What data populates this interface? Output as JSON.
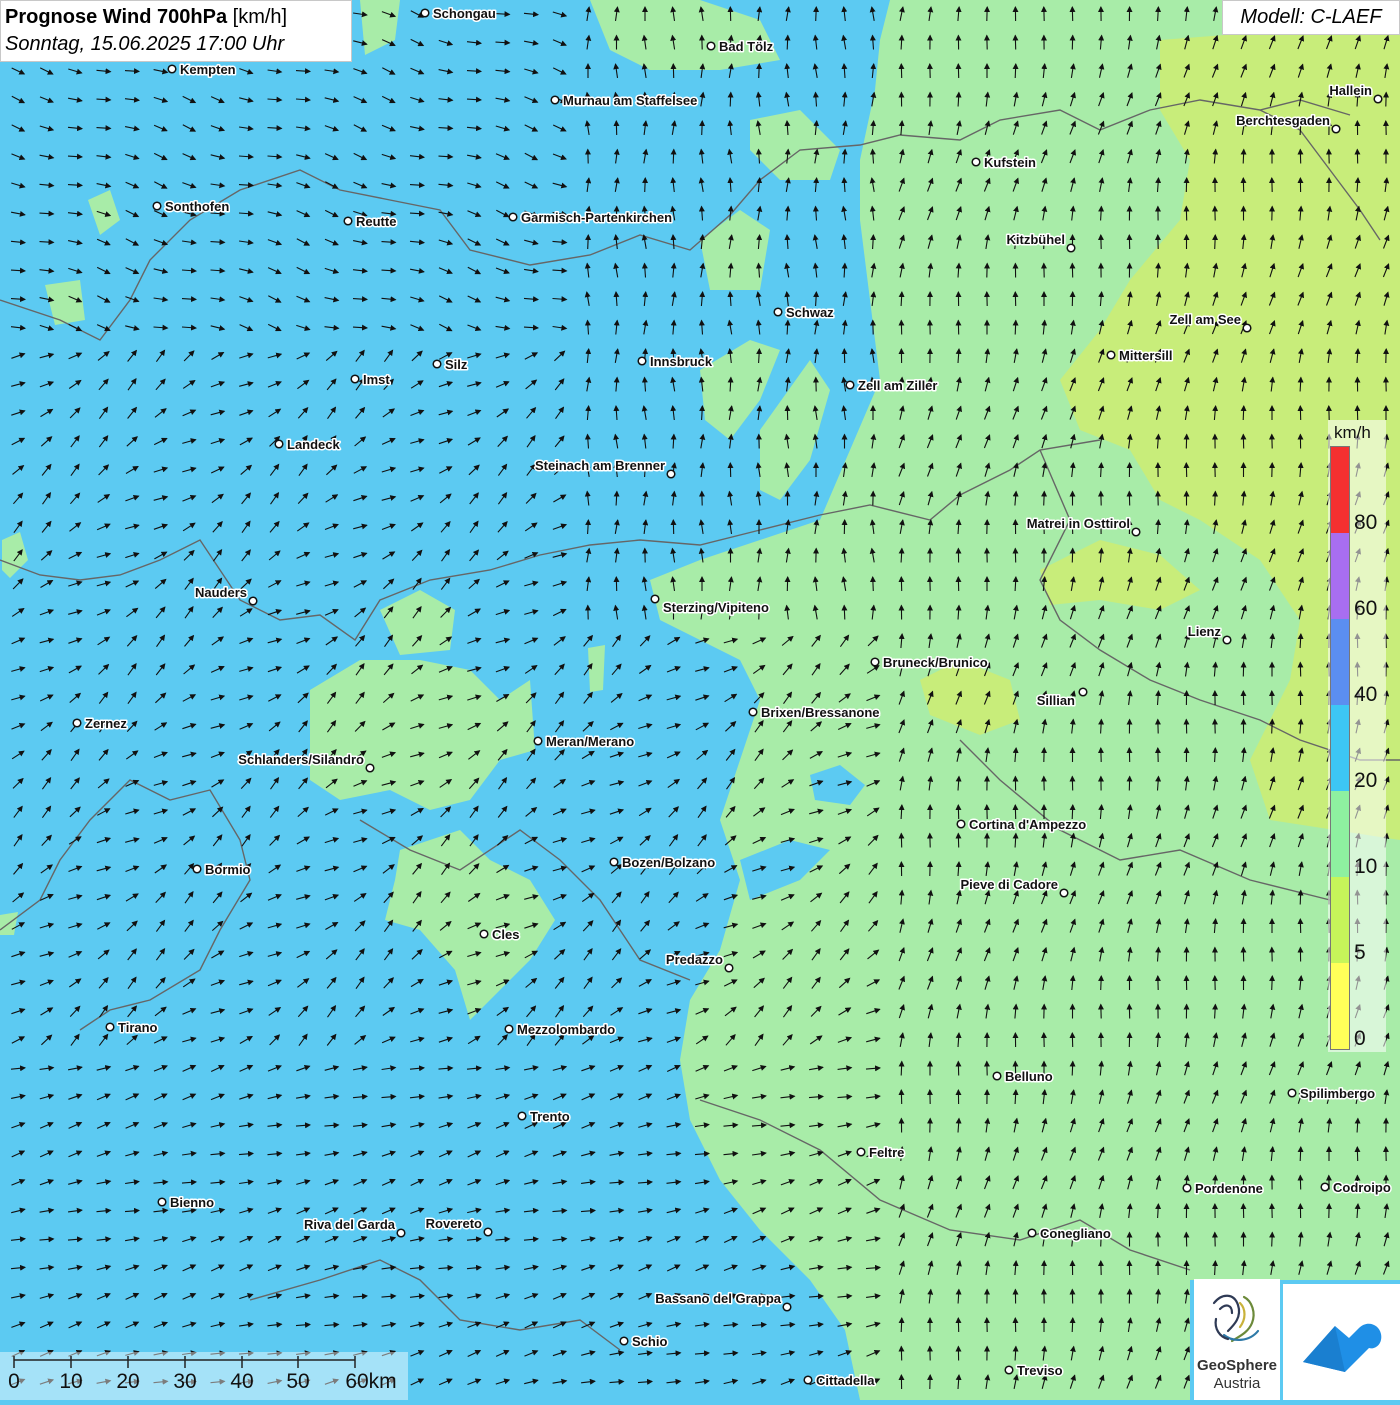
{
  "header": {
    "title_bold": "Prognose Wind 700hPa",
    "title_unit": "[km/h]",
    "datetime": "Sonntag, 15.06.2025 17:00 Uhr",
    "model": "Modell: C-LAEF"
  },
  "legend": {
    "unit": "km/h",
    "ticks": [
      "0",
      "5",
      "10",
      "20",
      "40",
      "60",
      "80"
    ],
    "colors": [
      "#ffff59",
      "#c6f55a",
      "#8ef0a0",
      "#3dc6f5",
      "#5b8ef0",
      "#a86ef0",
      "#f53030"
    ]
  },
  "scale_bar": {
    "labels": [
      "0",
      "10",
      "20",
      "30",
      "40",
      "50",
      "60km"
    ]
  },
  "logos": {
    "geosphere_line1": "GeoSphere",
    "geosphere_line2": "Austria",
    "geosphere_icon": "geosphere-logo-icon",
    "cloud_icon": "cloud-logo-icon"
  },
  "colors": {
    "water_blue": "#5ccaf2",
    "light_green": "#a8eca8",
    "yellow_green": "#c8ed7a",
    "border_gray": "#666666"
  },
  "cities": [
    {
      "name": "Schongau"
    },
    {
      "name": "Bad Tölz"
    },
    {
      "name": "Kempten"
    },
    {
      "name": "Murnau am Staffelsee"
    },
    {
      "name": "Hallein"
    },
    {
      "name": "Berchtesgaden"
    },
    {
      "name": "Kufstein"
    },
    {
      "name": "Sonthofen"
    },
    {
      "name": "Reutte"
    },
    {
      "name": "Garmisch-Partenkirchen"
    },
    {
      "name": "Kitzbühel"
    },
    {
      "name": "Schwaz"
    },
    {
      "name": "Zell am See"
    },
    {
      "name": "Mittersill"
    },
    {
      "name": "Imst"
    },
    {
      "name": "Silz"
    },
    {
      "name": "Innsbruck"
    },
    {
      "name": "Zell am Ziller"
    },
    {
      "name": "Landeck"
    },
    {
      "name": "Steinach am Brenner"
    },
    {
      "name": "Matrei in Osttirol"
    },
    {
      "name": "Nauders"
    },
    {
      "name": "Sterzing/Vipiteno"
    },
    {
      "name": "Lienz"
    },
    {
      "name": "Bruneck/Brunico"
    },
    {
      "name": "Sillian"
    },
    {
      "name": "Zernez"
    },
    {
      "name": "Brixen/Bressanone"
    },
    {
      "name": "Meran/Merano"
    },
    {
      "name": "Schlanders/Silandro"
    },
    {
      "name": "Cortina d'Ampezzo"
    },
    {
      "name": "Bormio"
    },
    {
      "name": "Bozen/Bolzano"
    },
    {
      "name": "Pieve di Cadore"
    },
    {
      "name": "Cles"
    },
    {
      "name": "Predazzo"
    },
    {
      "name": "Tirano"
    },
    {
      "name": "Mezzolombardo"
    },
    {
      "name": "Belluno"
    },
    {
      "name": "Spilimbergo"
    },
    {
      "name": "Trento"
    },
    {
      "name": "Feltre"
    },
    {
      "name": "Bienno"
    },
    {
      "name": "Pordenone"
    },
    {
      "name": "Codroipo"
    },
    {
      "name": "Riva del Garda"
    },
    {
      "name": "Rovereto"
    },
    {
      "name": "Conegliano"
    },
    {
      "name": "Bassano del Grappa"
    },
    {
      "name": "Schio"
    },
    {
      "name": "Treviso"
    },
    {
      "name": "Cittadella"
    }
  ]
}
